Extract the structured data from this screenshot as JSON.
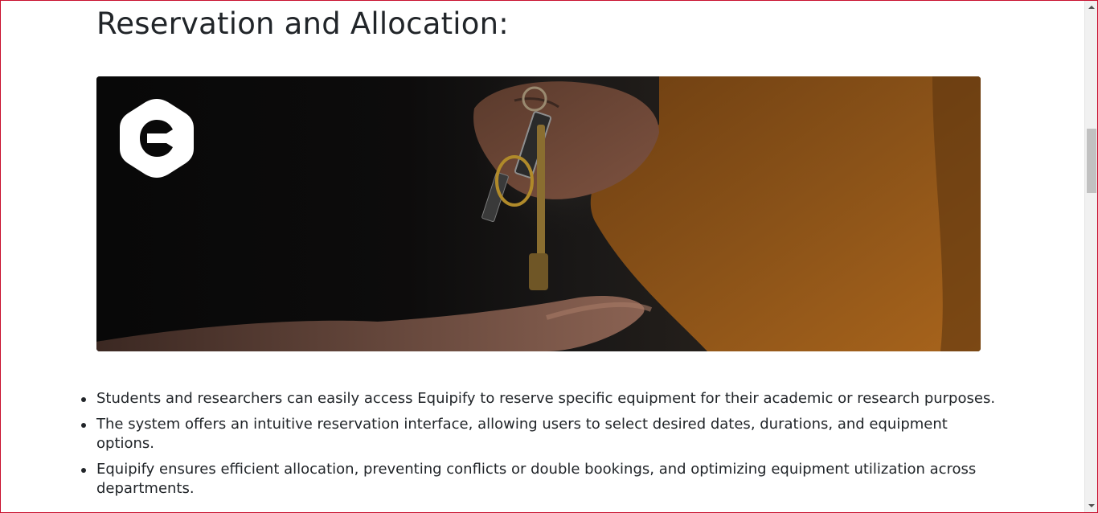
{
  "section": {
    "heading": "Reservation and Allocation:"
  },
  "hero": {
    "image_subject": "hand-passing-keys-photo",
    "logo_icon": "equipify-logo-icon"
  },
  "features": [
    "Students and researchers can easily access Equipify to reserve specific equipment for their academic or research purposes.",
    "The system offers an intuitive reservation interface, allowing users to select desired dates, durations, and equipment options.",
    "Equipify ensures efficient allocation, preventing conflicts or double bookings, and optimizing equipment utilization across departments."
  ],
  "colors": {
    "text": "#212529",
    "frame_border": "#c8102e",
    "jacket": "#a8641c",
    "key_brass": "#c9a24a",
    "hero_background": "#0c0b0b"
  }
}
